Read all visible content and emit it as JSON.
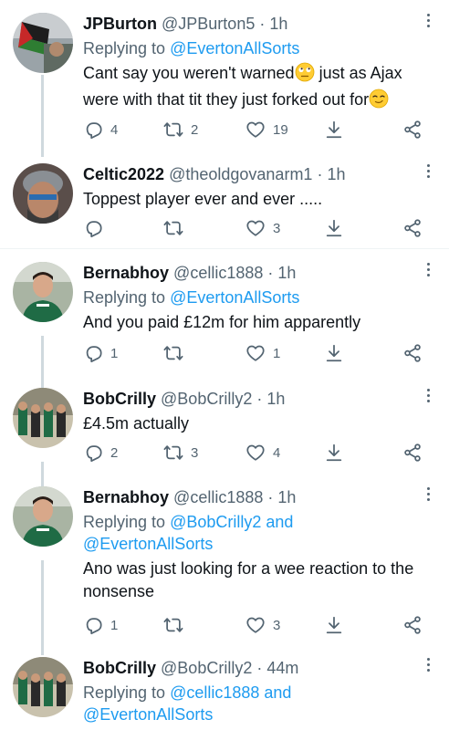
{
  "tweets": [
    {
      "name": "JPBurton",
      "handle": "@JPBurton5",
      "dot": "·",
      "time": "1h",
      "replying_prefix": "Replying to ",
      "replying_to": "@EvertonAllSorts",
      "replying_and": "",
      "replying_to2": "",
      "text_parts": [
        "Cant say you weren't warned",
        " just as Ajax were with that tit they just forked out for"
      ],
      "emojis": [
        "face-with-rolling-eyes",
        "smirking-face"
      ],
      "replies": "4",
      "retweets": "2",
      "likes": "19"
    },
    {
      "name": "Celtic2022",
      "handle": "@theoldgovanarm1",
      "dot": "·",
      "time": "1h",
      "text": "Toppest player ever and ever .....",
      "replies": "",
      "retweets": "",
      "likes": "3"
    },
    {
      "name": "Bernabhoy",
      "handle": "@cellic1888",
      "dot": "·",
      "time": "1h",
      "replying_prefix": "Replying to ",
      "replying_to": "@EvertonAllSorts",
      "text": "And you paid £12m for him apparently",
      "replies": "1",
      "retweets": "",
      "likes": "1"
    },
    {
      "name": "BobCrilly",
      "handle": "@BobCrilly2",
      "dot": "·",
      "time": "1h",
      "text": "£4.5m actually",
      "replies": "2",
      "retweets": "3",
      "likes": "4"
    },
    {
      "name": "Bernabhoy",
      "handle": "@cellic1888",
      "dot": "·",
      "time": "1h",
      "replying_prefix": "Replying to ",
      "replying_to": "@BobCrilly2",
      "replying_and": " and",
      "replying_to2": "@EvertonAllSorts",
      "text": "Ano was just looking for a wee reaction to the nonsense",
      "replies": "1",
      "retweets": "",
      "likes": "3"
    },
    {
      "name": "BobCrilly",
      "handle": "@BobCrilly2",
      "dot": "·",
      "time": "44m",
      "replying_prefix": "Replying to ",
      "replying_to": "@cellic1888",
      "replying_and": " and",
      "replying_to2": "@EvertonAllSorts"
    }
  ],
  "icons": {
    "reply": "reply-icon",
    "retweet": "retweet-icon",
    "like": "heart-icon",
    "bookmark": "download-icon",
    "share": "share-icon",
    "more": "more-icon"
  },
  "colors": {
    "text": "#0f1419",
    "secondary": "#536471",
    "link": "#1d9bf0",
    "divider": "#eff3f4",
    "thread_line": "#cfd9de"
  }
}
